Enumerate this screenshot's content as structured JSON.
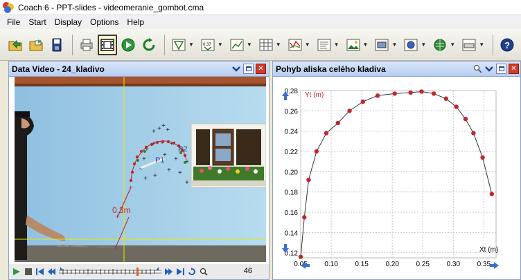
{
  "window": {
    "title": "Coach 6 - PPT-slides - videomeranie_gombot.cma"
  },
  "menu": [
    "File",
    "Start",
    "Display",
    "Options",
    "Help"
  ],
  "left_panel": {
    "title": "Data Video - 24_kladivo",
    "frame_number": "46"
  },
  "video_labels": {
    "scale": "0.3m",
    "point1": "P1",
    "point2": "P2"
  },
  "right_panel": {
    "title": "Pohyb aliska celého kladiva"
  },
  "colors": {
    "panel_header": "#c4d6f4",
    "graph_point": "#c0282d",
    "crosshair": "#e8e800"
  },
  "chart_data": {
    "type": "line",
    "xlabel": "Xt (m)",
    "ylabel": "Yt (m)",
    "xlim": [
      0.05,
      0.37
    ],
    "ylim": [
      0.115,
      0.28
    ],
    "xticks": [
      "0.05",
      "0.10",
      "0.15",
      "0.20",
      "0.25",
      "0.30",
      "0.35"
    ],
    "yticks": [
      "0.12",
      "0.14",
      "0.16",
      "0.18",
      "0.20",
      "0.22",
      "0.24",
      "0.26",
      "0.28"
    ],
    "grid": true,
    "points": [
      [
        0.05,
        0.116
      ],
      [
        0.056,
        0.155
      ],
      [
        0.063,
        0.192
      ],
      [
        0.076,
        0.22
      ],
      [
        0.092,
        0.238
      ],
      [
        0.111,
        0.248
      ],
      [
        0.13,
        0.26
      ],
      [
        0.152,
        0.269
      ],
      [
        0.176,
        0.275
      ],
      [
        0.204,
        0.277
      ],
      [
        0.23,
        0.278
      ],
      [
        0.248,
        0.279
      ],
      [
        0.268,
        0.277
      ],
      [
        0.288,
        0.272
      ],
      [
        0.305,
        0.264
      ],
      [
        0.32,
        0.252
      ],
      [
        0.333,
        0.238
      ],
      [
        0.348,
        0.214
      ],
      [
        0.363,
        0.178
      ]
    ]
  }
}
